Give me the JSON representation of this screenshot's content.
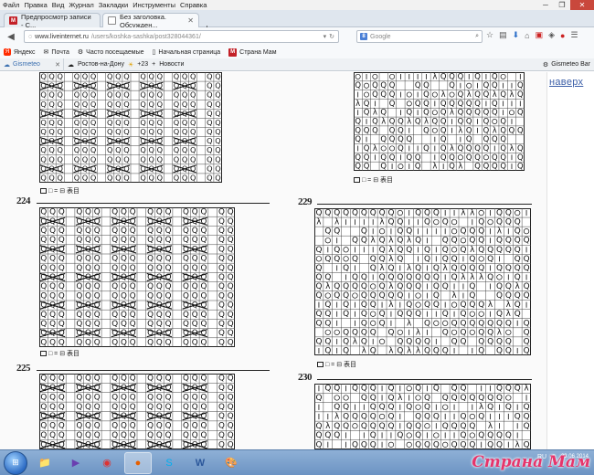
{
  "menu": [
    "Файл",
    "Правка",
    "Вид",
    "Журнал",
    "Закладки",
    "Инструменты",
    "Справка"
  ],
  "tabs": [
    {
      "label": "Предпросмотр записи - С...",
      "icon": "M"
    },
    {
      "label": "Без заголовка. Обсужден...",
      "icon": ""
    }
  ],
  "url": {
    "host": "www.liveinternet.ru",
    "path": "/users/koshka-sashka/post328044361/"
  },
  "search": {
    "placeholder": "Google"
  },
  "bookmarks": [
    "Яндекс",
    "Почта",
    "Часто посещаемые",
    "Начальная страница",
    "Страна Мам"
  ],
  "weather": {
    "brand": "Gismeteo",
    "city": "Ростов-на-Дону",
    "temp": "+23",
    "news": "Новости",
    "bar": "Gismeteo Bar"
  },
  "sidebar": {
    "top_link": "наверх"
  },
  "patterns": [
    {
      "number": "",
      "legend": "□ = ⊟  表目"
    },
    {
      "number": "",
      "legend": "□ = ⊟  表目"
    },
    {
      "number": "224",
      "legend": "□ = ⊟  表目"
    },
    {
      "number": "229",
      "legend": "□ = ⊟  表目"
    },
    {
      "number": "225",
      "legend": ""
    },
    {
      "number": "230",
      "legend": ""
    }
  ],
  "tray": {
    "lang": "RU",
    "time": "23.06.2014"
  },
  "watermark": "Страна Мам"
}
